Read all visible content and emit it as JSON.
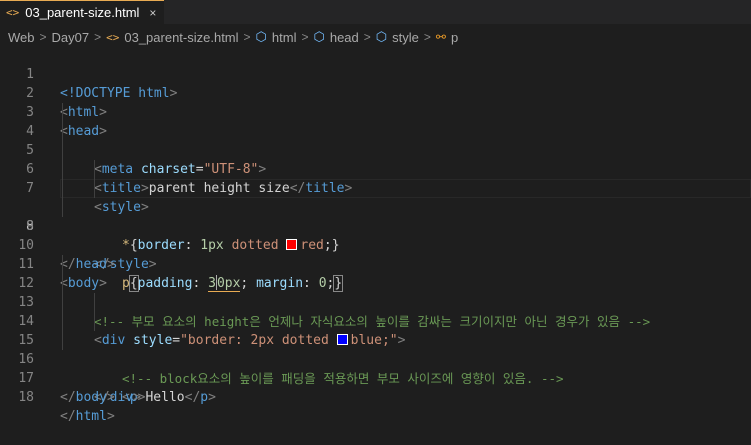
{
  "tab": {
    "icon": "<>",
    "name": "03_parent-size.html",
    "close": "×"
  },
  "breadcrumb": {
    "items": [
      {
        "label": "Web",
        "icon": ""
      },
      {
        "label": "Day07",
        "icon": ""
      },
      {
        "label": "03_parent-size.html",
        "icon": "<>"
      },
      {
        "label": "html",
        "icon": "cube"
      },
      {
        "label": "head",
        "icon": "cube"
      },
      {
        "label": "style",
        "icon": "cube"
      },
      {
        "label": "p",
        "icon": "p"
      }
    ],
    "separator": ">"
  },
  "editor": {
    "line_numbers": [
      "1",
      "2",
      "3",
      "4",
      "5",
      "6",
      "7",
      "8",
      "9",
      "10",
      "11",
      "12",
      "13",
      "14",
      "15",
      "16",
      "17",
      "18"
    ],
    "lines": {
      "l1": [
        "<!DOCTYPE",
        " html",
        ">"
      ],
      "l2": [
        "<",
        "html",
        ">"
      ],
      "l3": [
        "<",
        "head",
        ">"
      ],
      "l4": [
        "<",
        "meta",
        " charset",
        "=",
        "\"UTF-8\"",
        ">"
      ],
      "l5": [
        "<",
        "title",
        ">",
        "parent height size",
        "</",
        "title",
        ">"
      ],
      "l6": [
        "<",
        "style",
        ">"
      ],
      "l7": [
        "*",
        "{",
        "border",
        ": ",
        "1px",
        " dotted ",
        "red",
        ";}"
      ],
      "l8": [
        "p",
        "{",
        "padding",
        ": ",
        "3",
        "0px",
        "; ",
        "margin",
        ": ",
        "0",
        ";",
        "}"
      ],
      "l9": [
        "</",
        "style",
        ">"
      ],
      "l10": [
        "</",
        "head",
        ">"
      ],
      "l11": [
        "<",
        "body",
        ">"
      ],
      "l12": [
        "<!-- 부모 요소의 height은 언제나 자식요소의 높이를 감싸는 크기이지만 아닌 경우가 있음 -->"
      ],
      "l13": [
        "<",
        "div",
        " style",
        "=",
        "\"border: 2px dotted ",
        "blue;\"",
        ">"
      ],
      "l14": [
        "<!-- block요소의 높이를 패딩을 적용하면 부모 사이즈에 영향이 있음. -->"
      ],
      "l15": [
        "<",
        "p",
        ">",
        "Hello",
        "</",
        "p",
        ">"
      ],
      "l16": [
        "</",
        "div",
        ">"
      ],
      "l17": [
        "</",
        "body",
        ">"
      ],
      "l18": [
        "</",
        "html",
        ">"
      ]
    },
    "swatches": {
      "red": "#ff0000",
      "blue": "#0000ff"
    }
  },
  "colors": {
    "tab_accent": "#e8ab53",
    "background": "#1e1e1e"
  }
}
